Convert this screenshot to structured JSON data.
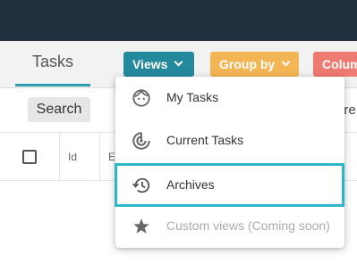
{
  "tabs": {
    "active": "Tasks"
  },
  "buttons": {
    "views": "Views",
    "group_by": "Group by",
    "columns": "Colum"
  },
  "toolbar": {
    "search": "Search",
    "more": "ore"
  },
  "table": {
    "col_id": "Id",
    "col_e": "E"
  },
  "menu": {
    "items": [
      {
        "label": "My Tasks",
        "icon": "face-icon"
      },
      {
        "label": "Current Tasks",
        "icon": "target-icon"
      },
      {
        "label": "Archives",
        "icon": "history-icon"
      },
      {
        "label": "Custom views (Coming soon)",
        "icon": "star-icon"
      }
    ]
  },
  "colors": {
    "accent": "#25899d",
    "group_by": "#f4b555",
    "columns": "#ee7b72",
    "focus_border": "#2eb7c7",
    "topbar": "#233040"
  }
}
